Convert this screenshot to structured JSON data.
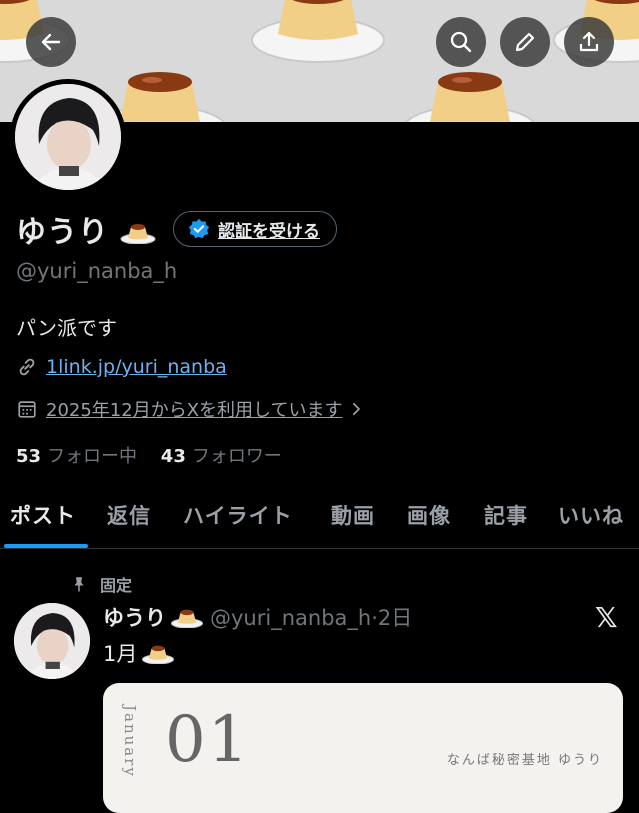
{
  "profile": {
    "display_name": "ゆうり",
    "verify_label": "認証を受ける",
    "handle": "@yuri_nanba_h",
    "bio": "パン派です",
    "link": "1link.jp/yuri_nanba",
    "joined": "2025年12月からXを利用しています",
    "following_count": "53",
    "following_label": "フォロー中",
    "followers_count": "43",
    "followers_label": "フォロワー"
  },
  "tabs": [
    "ポスト",
    "返信",
    "ハイライト",
    "動画",
    "画像",
    "記事",
    "いいね"
  ],
  "post": {
    "pinned_label": "固定",
    "author": "ゆうり",
    "handle_time": "@yuri_nanba_h·2日",
    "text": "1月",
    "card": {
      "month": "January",
      "number": "01",
      "brand": "なんば秘密基地 ゆうり"
    }
  },
  "colors": {
    "accent": "#1d9bf0",
    "link": "#6fb0f2",
    "background": "#000000"
  }
}
